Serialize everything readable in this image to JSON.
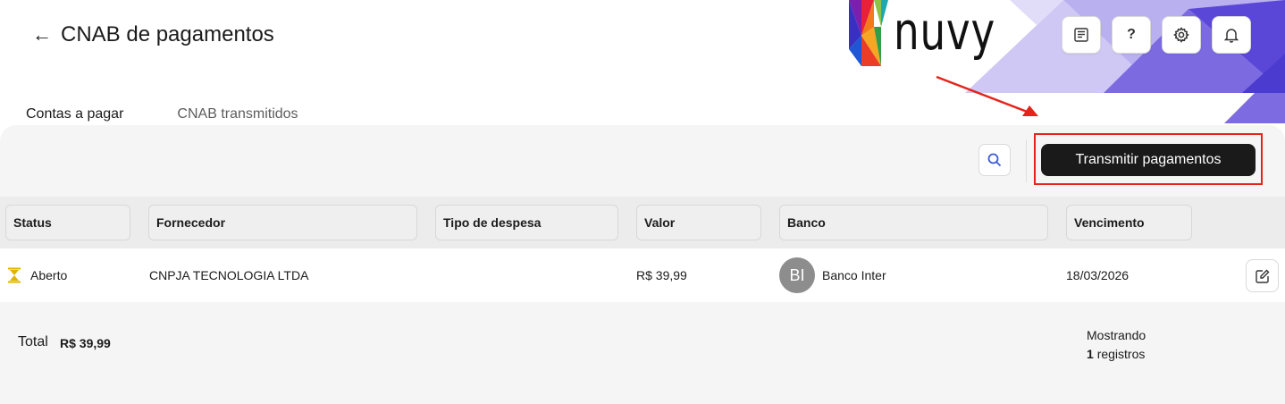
{
  "header": {
    "back_icon": "arrow-left-icon",
    "title": "CNAB de pagamentos",
    "logo_text": "nuvy",
    "actions": [
      {
        "name": "report-button",
        "icon": "report-icon"
      },
      {
        "name": "help-button",
        "icon": "question-icon",
        "label": "?"
      },
      {
        "name": "settings-button",
        "icon": "gear-icon"
      },
      {
        "name": "notifications-button",
        "icon": "bell-icon"
      }
    ]
  },
  "tabs": [
    {
      "label": "Contas a pagar",
      "active": true
    },
    {
      "label": "CNAB transmitidos",
      "active": false
    }
  ],
  "toolbar": {
    "search_icon": "search-icon",
    "transmit_label": "Transmitir pagamentos"
  },
  "table": {
    "columns": [
      "Status",
      "Fornecedor",
      "Tipo de despesa",
      "Valor",
      "Banco",
      "Vencimento"
    ],
    "rows": [
      {
        "status_icon": "hourglass-icon",
        "status": "Aberto",
        "fornecedor": "CNPJA TECNOLOGIA LTDA",
        "tipo_despesa": "",
        "valor": "R$ 39,99",
        "banco_initials": "BI",
        "banco": "Banco Inter",
        "vencimento": "18/03/2026",
        "edit_icon": "edit-icon"
      }
    ]
  },
  "footer": {
    "total_label": "Total",
    "total_value": "R$ 39,99",
    "showing_label": "Mostrando",
    "showing_count": "1",
    "showing_suffix": "registros"
  },
  "colors": {
    "primary_button": "#1a1a1a",
    "highlight": "#e5231b",
    "status_pending": "#e0b400",
    "deco_purple": "#5b4ad6"
  }
}
